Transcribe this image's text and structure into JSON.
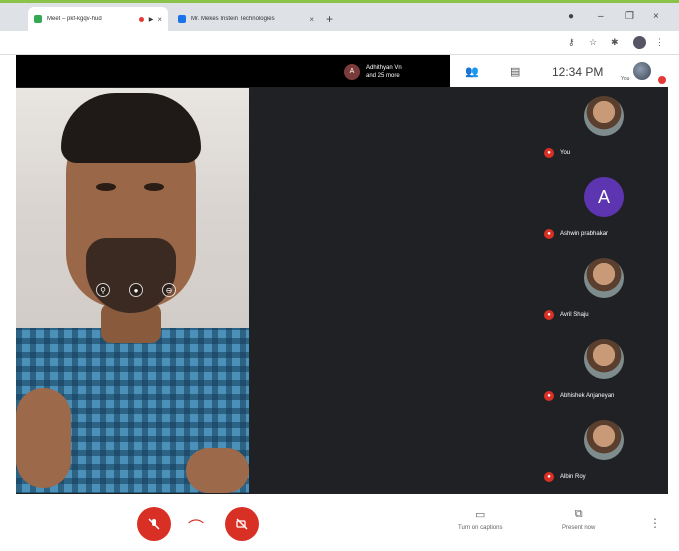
{
  "browser": {
    "tabs": [
      {
        "title": "Meet – pkf-kgqv-hud",
        "active": true,
        "recording": true
      },
      {
        "title": "Mr. Mekes Instein Technologies",
        "active": false
      }
    ],
    "new_tab": "+",
    "window_controls": [
      "–",
      "❐",
      "×"
    ]
  },
  "meet": {
    "presenter": {
      "initial": "A",
      "name_line1": "Adhithyan Vn",
      "name_line2": "and 25 more"
    },
    "time": "12:34 PM",
    "self_label": "You",
    "participants": [
      {
        "name": "You",
        "avatar": "photo",
        "initial": ""
      },
      {
        "name": "Ashwin prabhakar",
        "avatar": "letter",
        "initial": "A"
      },
      {
        "name": "Avril Shaju",
        "avatar": "photo",
        "initial": ""
      },
      {
        "name": "Abhishek Anjaneyan",
        "avatar": "photo",
        "initial": ""
      },
      {
        "name": "Albin Roy",
        "avatar": "photo",
        "initial": ""
      }
    ],
    "bottom": {
      "captions_label": "Turn on captions",
      "present_label": "Present now"
    }
  },
  "colors": {
    "accent_red": "#d93025",
    "stage_bg": "#202124",
    "letter_avatar": "#5e35b1"
  }
}
